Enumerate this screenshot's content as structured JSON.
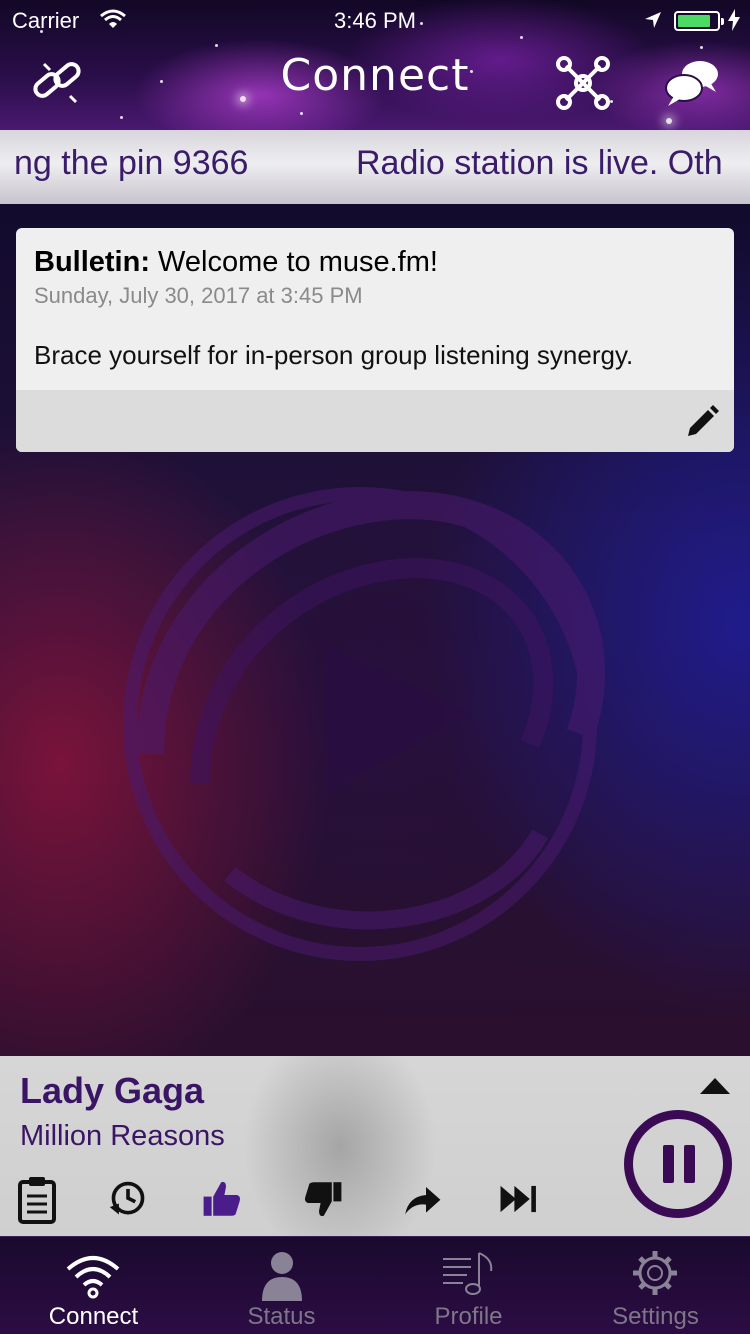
{
  "status_bar": {
    "carrier": "Carrier",
    "time": "3:46 PM"
  },
  "nav": {
    "title": "Connect",
    "left_icon": "link-broken-icon",
    "right_icons": [
      "network-icon",
      "chat-bubbles-icon"
    ]
  },
  "ticker": {
    "text_a": "ng the pin 9366",
    "text_b": "Radio station is live. Oth"
  },
  "bulletin": {
    "label": "Bulletin:",
    "title": " Welcome to muse.fm!",
    "date": "Sunday, July 30, 2017 at 3:45 PM",
    "body": "Brace yourself for in-person group listening synergy.",
    "edit_icon": "pencil-icon"
  },
  "now_playing": {
    "artist": "Lady Gaga",
    "track": "Million Reasons",
    "state": "playing",
    "actions": [
      "clipboard-icon",
      "history-icon",
      "thumbs-up-icon",
      "thumbs-down-icon",
      "share-icon",
      "skip-icon"
    ],
    "liked": true,
    "accent_color": "#4b1c8c"
  },
  "tabs": [
    {
      "label": "Connect",
      "icon": "wifi-icon",
      "active": true
    },
    {
      "label": "Status",
      "icon": "person-icon",
      "active": false
    },
    {
      "label": "Profile",
      "icon": "music-list-icon",
      "active": false
    },
    {
      "label": "Settings",
      "icon": "gear-icon",
      "active": false
    }
  ]
}
